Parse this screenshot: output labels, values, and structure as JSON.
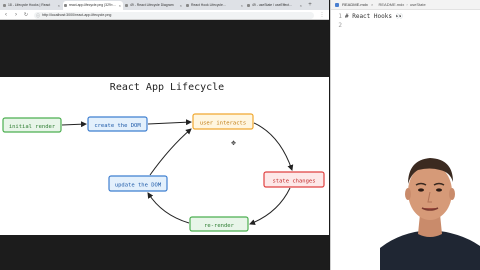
{
  "browser": {
    "tabs": [
      {
        "label": "18 - Lifecycle Hooks | React",
        "active": false
      },
      {
        "label": "react-app-lifecycle.png (329×...",
        "active": true
      },
      {
        "label": "49 - React Lifecycle Diagram",
        "active": false
      },
      {
        "label": "React Hook Lifecycle...",
        "active": false
      },
      {
        "label": "49 - useState / useEffect...",
        "active": false
      }
    ],
    "url": "http://localhost:3000/react-app-lifecycle.png"
  },
  "diagram": {
    "title": "React App Lifecycle",
    "nodes": {
      "initial": "initial render",
      "create": "create the DOM",
      "interacts": "user interacts",
      "state": "state changes",
      "rerender": "re-render",
      "update": "update the DOM"
    },
    "colors": {
      "initial": "#4caf50",
      "create": "#3f7fd0",
      "interacts": "#f0a830",
      "state": "#e04040",
      "rerender": "#4caf50",
      "update": "#3f7fd0"
    }
  },
  "editor": {
    "tab_file": "README.mdx",
    "breadcrumb": "README.mdx",
    "breadcrumb_sep": "›",
    "breadcrumb_section": "useState",
    "lines": [
      {
        "number": "1",
        "text": "# React Hooks 👀"
      },
      {
        "number": "2",
        "text": ""
      }
    ]
  }
}
